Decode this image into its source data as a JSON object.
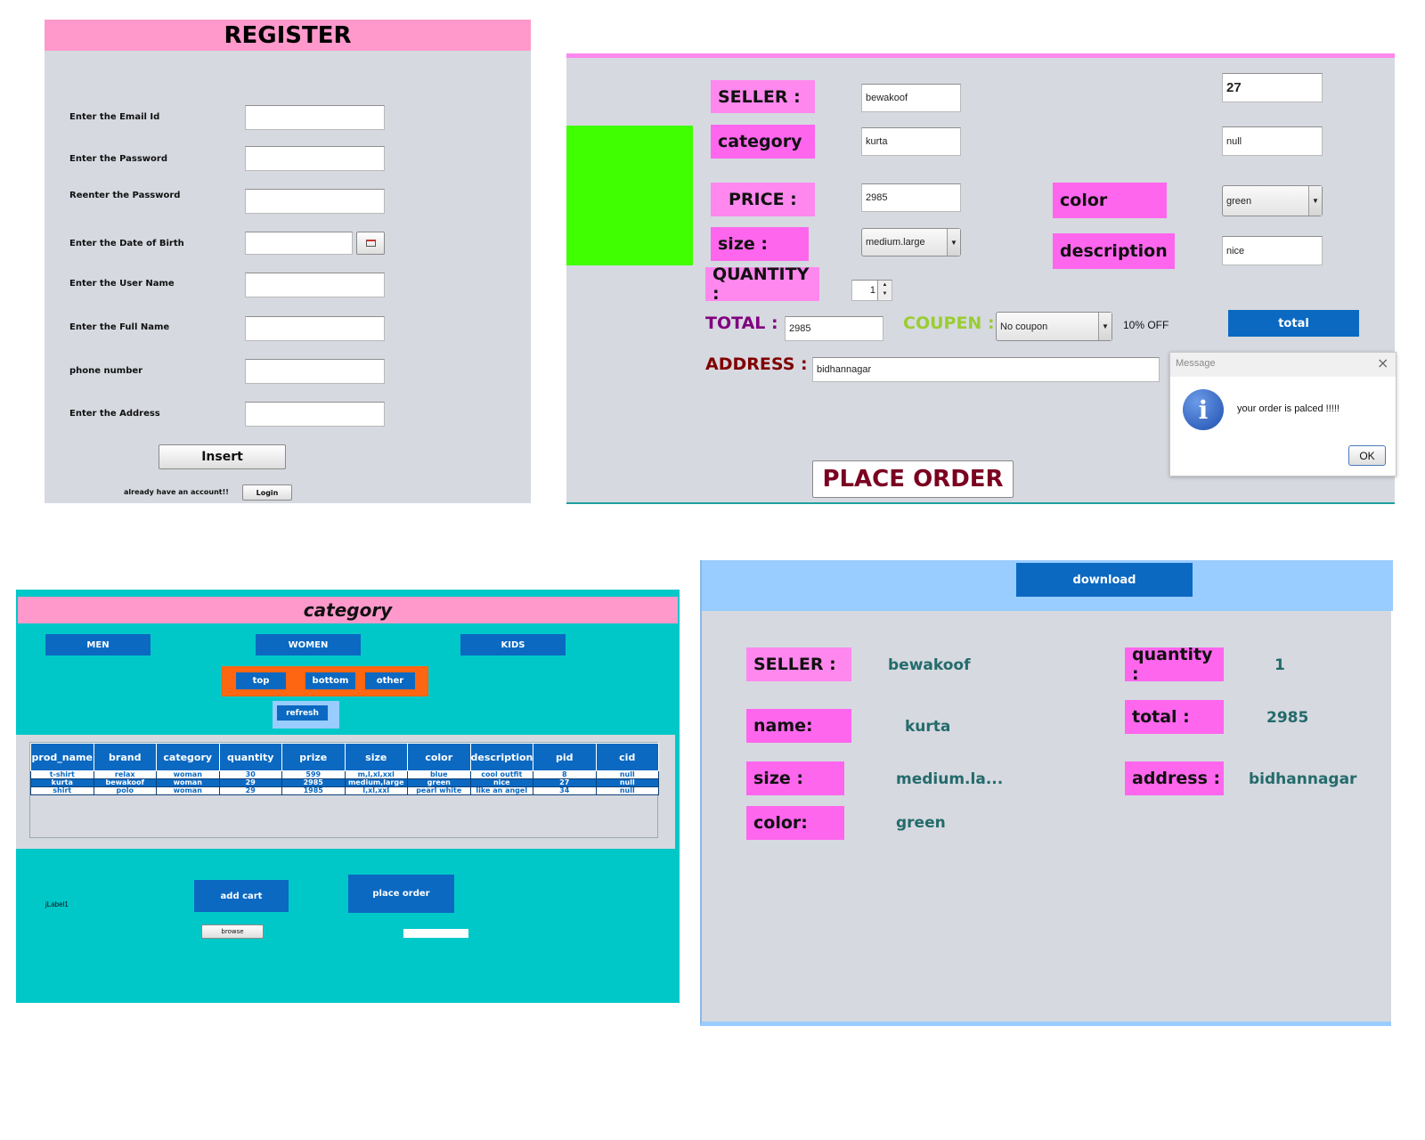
{
  "register": {
    "title": "REGISTER",
    "fields": [
      {
        "label": "Enter the Email Id",
        "value": ""
      },
      {
        "label": "Enter the Password",
        "value": ""
      },
      {
        "label": "Reenter the Password",
        "value": ""
      },
      {
        "label": "Enter the Date of Birth",
        "value": ""
      },
      {
        "label": "Enter the User Name",
        "value": ""
      },
      {
        "label": "Enter the Full Name",
        "value": ""
      },
      {
        "label": "phone number",
        "value": ""
      },
      {
        "label": "Enter the Address",
        "value": ""
      }
    ],
    "insert_label": "Insert",
    "already_text": "already have an account!!",
    "login_label": "Login",
    "calendar_icon": "calendar-icon"
  },
  "order": {
    "seller_label": "SELLER :",
    "seller_value": "bewakoof",
    "category_label": "category",
    "category_value": "kurta",
    "price_label": "PRICE :",
    "price_value": "2985",
    "size_label": "size :",
    "size_value": "medium.large",
    "quantity_label": "QUANTITY :",
    "quantity_value": "1",
    "pid_value": "27",
    "cid_value": "null",
    "color_label": "color",
    "color_value": "green",
    "description_label": "description",
    "description_value": "nice",
    "total_label": "TOTAL :",
    "total_value": "2985",
    "coupon_label": "COUPEN :",
    "coupon_value": "No coupon",
    "discount_text": "10% OFF",
    "total_button": "total",
    "address_label": "ADDRESS :",
    "address_value": "bidhannagar",
    "place_order": "PLACE ORDER",
    "image_color": "#40ff00",
    "dialog": {
      "title": "Message",
      "message": "your order is palced !!!!!",
      "ok": "OK",
      "icon": "info-icon"
    }
  },
  "category": {
    "title": "category",
    "main_tabs": [
      "MEN",
      "WOMEN",
      "KIDS"
    ],
    "sub_tabs": [
      "top",
      "bottom",
      "other"
    ],
    "refresh": "refresh",
    "columns": [
      "prod_name",
      "brand",
      "category",
      "quantity",
      "prize",
      "size",
      "color",
      "description",
      "pid",
      "cid"
    ],
    "rows": [
      [
        "t-shirt",
        "relax",
        "woman",
        "30",
        "599",
        "m,l,xl,xxl",
        "blue",
        "cool outfit",
        "8",
        "null"
      ],
      [
        "kurta",
        "bewakoof",
        "woman",
        "29",
        "2985",
        "medium,large",
        "green",
        "nice",
        "27",
        "null"
      ],
      [
        "shirt",
        "polo",
        "woman",
        "29",
        "1985",
        "l,xl,xxl",
        "pearl white",
        "like an angel",
        "34",
        "null"
      ]
    ],
    "selected_row": 1,
    "jlabel": "jLabel1",
    "add_cart": "add cart",
    "place_order": "place order",
    "browse": "browse"
  },
  "summary": {
    "download": "download",
    "seller_label": "SELLER :",
    "seller_value": "bewakoof",
    "name_label": "name:",
    "name_value": "kurta",
    "size_label": "size :",
    "size_value": "medium.la...",
    "color_label": "color:",
    "color_value": "green",
    "quantity_label": "quantity :",
    "quantity_value": "1",
    "total_label": "total :",
    "total_value": "2985",
    "address_label": "address :",
    "address_value": "bidhannagar"
  },
  "colors": {
    "pink_header": "#ff99cc",
    "magenta_label": "#ff66ee",
    "blue_button": "#0b69c2",
    "teal_bg": "#00c8c8",
    "panel_gray": "#d6d9e0",
    "light_blue": "#99ccff"
  }
}
